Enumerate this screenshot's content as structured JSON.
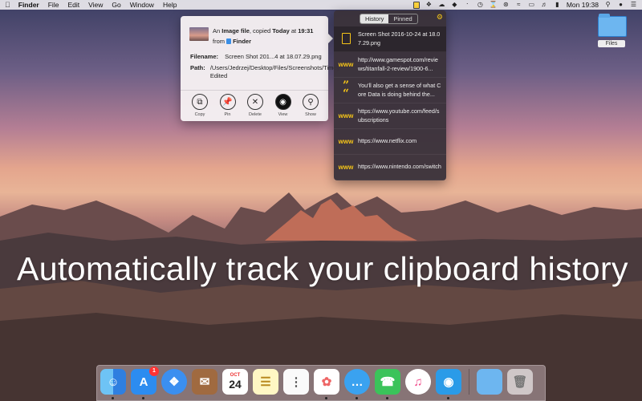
{
  "menubar": {
    "app_name": "Finder",
    "items": [
      "File",
      "Edit",
      "View",
      "Go",
      "Window",
      "Help"
    ],
    "clock": "Mon 19:38"
  },
  "desktop": {
    "folder_label": "Files"
  },
  "clip_panel": {
    "tabs": [
      "History",
      "Pinned"
    ],
    "active_tab": "History",
    "items": [
      {
        "type": "file",
        "icon": "document-icon",
        "text": "Screen Shot 2016-10-24 at 18.07.29.png"
      },
      {
        "type": "url",
        "icon": "www",
        "text": "http://www.gamespot.com/reviews/titanfall-2-review/1900-6..."
      },
      {
        "type": "text",
        "icon": "quote-icon",
        "text": "You'll also get a sense of what Core Data is doing behind the..."
      },
      {
        "type": "url",
        "icon": "www",
        "text": "https://www.youtube.com/feed/subscriptions"
      },
      {
        "type": "url",
        "icon": "www",
        "text": "https://www.netflix.com"
      },
      {
        "type": "url",
        "icon": "www",
        "text": "https://www.nintendo.com/switch"
      }
    ]
  },
  "detail": {
    "prefix": "An",
    "kind": "Image file",
    "copied": ", copied",
    "when": "Today",
    "at": "at",
    "time": "19:31",
    "from": "from",
    "source": "Finder",
    "filename_label": "Filename:",
    "filename": "Screen Shot 201...4 at 18.07.29.png",
    "path_label": "Path:",
    "path": "/Users/Jedrzej/Desktop/Files/Screenshots/Timey Edited",
    "actions": [
      "Copy",
      "Pin",
      "Delete",
      "View",
      "Show"
    ]
  },
  "hero": {
    "headline": "Automatically track your clipboard history"
  },
  "dock": {
    "app_store_badge": "1",
    "calendar_month": "OCT",
    "calendar_day": "24"
  },
  "colors": {
    "accent": "#f5c518",
    "panel_bg": "#3a323a",
    "popup_bg": "#f5f0f2"
  }
}
